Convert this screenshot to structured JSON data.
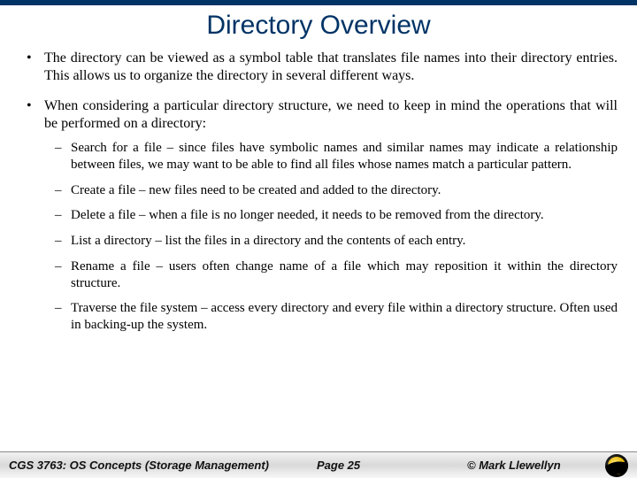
{
  "title": "Directory Overview",
  "bullets": {
    "b1": "The directory can be viewed as a symbol table that translates file names into their directory entries.  This allows us to organize the directory in several different ways.",
    "b2": "When considering a particular directory structure, we need to keep in mind the operations that will be performed on a directory:"
  },
  "ops": {
    "search": {
      "head": "Search for a file",
      "tail": " – since files have symbolic names and similar names may indicate a relationship between files, we may want to be able to find all files whose names match a particular pattern."
    },
    "create": {
      "head": "Create a file",
      "tail": " – new files need to be created and added to the directory."
    },
    "delete": {
      "head": "Delete a file",
      "tail": " – when a file is no longer needed, it needs to be removed from the directory."
    },
    "list": {
      "head": "List a directory",
      "tail": " – list the files in a directory and the contents of each entry."
    },
    "rename": {
      "head": "Rename a file",
      "tail": " – users often change name of a file which may reposition it within the directory structure."
    },
    "traverse": {
      "head": "Traverse the file system",
      "tail": " – access every directory and every file within a directory structure.  Often used in backing-up the system."
    }
  },
  "footer": {
    "course": "CGS 3763: OS Concepts (Storage Management)",
    "page": "Page 25",
    "copyright": "© Mark Llewellyn"
  }
}
